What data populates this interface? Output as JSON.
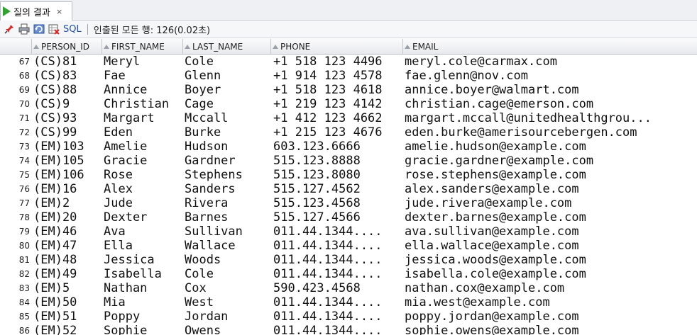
{
  "tab": {
    "title": "질의 결과",
    "close_glyph": "×",
    "accent": "#2fa52f"
  },
  "toolbar": {
    "pin_icon": "pin-icon",
    "sql_label": "SQL",
    "status": "인출된 모든 행: 126(0.02초)"
  },
  "columns": [
    "PERSON_ID",
    "FIRST_NAME",
    "LAST_NAME",
    "PHONE",
    "EMAIL"
  ],
  "rows": [
    {
      "rn": "67",
      "id": "(CS)81",
      "first": "Meryl",
      "last": "Cole",
      "phone": "+1 518 123 4496",
      "email": "meryl.cole@carmax.com"
    },
    {
      "rn": "68",
      "id": "(CS)83",
      "first": "Fae",
      "last": "Glenn",
      "phone": "+1 914 123 4578",
      "email": "fae.glenn@nov.com"
    },
    {
      "rn": "69",
      "id": "(CS)88",
      "first": "Annice",
      "last": "Boyer",
      "phone": "+1 518 123 4618",
      "email": "annice.boyer@walmart.com"
    },
    {
      "rn": "70",
      "id": "(CS)9",
      "first": "Christian",
      "last": "Cage",
      "phone": "+1 219 123 4142",
      "email": "christian.cage@emerson.com"
    },
    {
      "rn": "71",
      "id": "(CS)93",
      "first": "Margart",
      "last": "Mccall",
      "phone": "+1 412 123 4662",
      "email": "margart.mccall@unitedhealthgrou..."
    },
    {
      "rn": "72",
      "id": "(CS)99",
      "first": "Eden",
      "last": "Burke",
      "phone": "+1 215 123 4676",
      "email": "eden.burke@amerisourcebergen.com"
    },
    {
      "rn": "73",
      "id": "(EM)103",
      "first": "Amelie",
      "last": "Hudson",
      "phone": "603.123.6666",
      "email": "amelie.hudson@example.com"
    },
    {
      "rn": "74",
      "id": "(EM)105",
      "first": "Gracie",
      "last": "Gardner",
      "phone": "515.123.8888",
      "email": "gracie.gardner@example.com"
    },
    {
      "rn": "75",
      "id": "(EM)106",
      "first": "Rose",
      "last": "Stephens",
      "phone": "515.123.8080",
      "email": "rose.stephens@example.com"
    },
    {
      "rn": "76",
      "id": "(EM)16",
      "first": "Alex",
      "last": "Sanders",
      "phone": "515.127.4562",
      "email": "alex.sanders@example.com"
    },
    {
      "rn": "77",
      "id": "(EM)2",
      "first": "Jude",
      "last": "Rivera",
      "phone": "515.123.4568",
      "email": "jude.rivera@example.com"
    },
    {
      "rn": "78",
      "id": "(EM)20",
      "first": "Dexter",
      "last": "Barnes",
      "phone": "515.127.4566",
      "email": "dexter.barnes@example.com"
    },
    {
      "rn": "79",
      "id": "(EM)46",
      "first": "Ava",
      "last": "Sullivan",
      "phone": "011.44.1344....",
      "email": "ava.sullivan@example.com"
    },
    {
      "rn": "80",
      "id": "(EM)47",
      "first": "Ella",
      "last": "Wallace",
      "phone": "011.44.1344....",
      "email": "ella.wallace@example.com"
    },
    {
      "rn": "81",
      "id": "(EM)48",
      "first": "Jessica",
      "last": "Woods",
      "phone": "011.44.1344....",
      "email": "jessica.woods@example.com"
    },
    {
      "rn": "82",
      "id": "(EM)49",
      "first": "Isabella",
      "last": "Cole",
      "phone": "011.44.1344....",
      "email": "isabella.cole@example.com"
    },
    {
      "rn": "83",
      "id": "(EM)5",
      "first": "Nathan",
      "last": "Cox",
      "phone": "590.423.4568",
      "email": "nathan.cox@example.com"
    },
    {
      "rn": "84",
      "id": "(EM)50",
      "first": "Mia",
      "last": "West",
      "phone": "011.44.1344....",
      "email": "mia.west@example.com"
    },
    {
      "rn": "85",
      "id": "(EM)51",
      "first": "Poppy",
      "last": "Jordan",
      "phone": "011.44.1344....",
      "email": "poppy.jordan@example.com"
    },
    {
      "rn": "86",
      "id": "(EM)52",
      "first": "Sophie",
      "last": "Owens",
      "phone": "011.44.1344....",
      "email": "sophie.owens@example.com"
    }
  ]
}
